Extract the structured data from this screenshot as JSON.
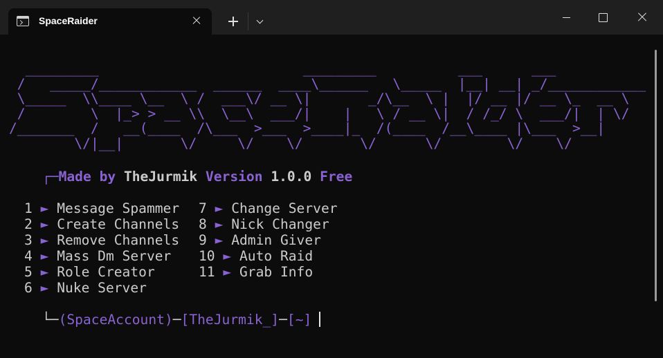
{
  "window": {
    "tab_title": "SpaceRaider",
    "icons": [
      "terminal-icon",
      "close-icon",
      "plus-icon",
      "chevron-down-icon",
      "minimize-icon",
      "maximize-icon",
      "window-close-icon"
    ]
  },
  "banner": {
    "ascii_art": "  _________                         _________          ___      ___\n /   _____/____________  ______  ____\\______   \\_____  |__| __| _/____________\n \\_____  \\\\____ \\__  \\ /  ___\\/ __ \\|       _/\\__  \\ |  |/ __ |/ __ \\_  __ \\\n /        \\  |_> > __ \\\\  \\__\\  ___/|    |   \\ / __ \\|  / /_/ \\  ___/|  | \\/\n/_______  /   __(____  /\\___  >___  >____|_  /(____  /__\\____ |\\___  >__|\n        \\/|__|       \\/     \\/    \\/       \\/      \\/        \\/    \\/"
  },
  "credit": {
    "corner": "┌─",
    "made_by": "Made by",
    "author": "TheJurmik",
    "version_label": "Version",
    "version_number": "1.0.0",
    "edition": "Free"
  },
  "menu": {
    "arrow": "►",
    "left": [
      {
        "num": "1",
        "label": "Message Spammer"
      },
      {
        "num": "2",
        "label": "Create Channels"
      },
      {
        "num": "3",
        "label": "Remove Channels"
      },
      {
        "num": "4",
        "label": "Mass Dm Server"
      },
      {
        "num": "5",
        "label": "Role Creator"
      },
      {
        "num": "6",
        "label": "Nuke Server"
      }
    ],
    "right": [
      {
        "num": "7",
        "label": "Change Server"
      },
      {
        "num": "8",
        "label": "Nick Changer"
      },
      {
        "num": "9",
        "label": "Admin Giver"
      },
      {
        "num": "10",
        "label": "Auto Raid"
      },
      {
        "num": "11",
        "label": "Grab Info"
      }
    ]
  },
  "prompt": {
    "corner": "└─",
    "account": "(SpaceAccount)",
    "dash1": "─",
    "user": "[TheJurmik_]",
    "dash2": "─",
    "path": "[~]"
  },
  "colors": {
    "accent": "#8a63d2",
    "text": "#cccccc",
    "background": "#0c0c0c",
    "titlebar": "#1f1f1f"
  }
}
